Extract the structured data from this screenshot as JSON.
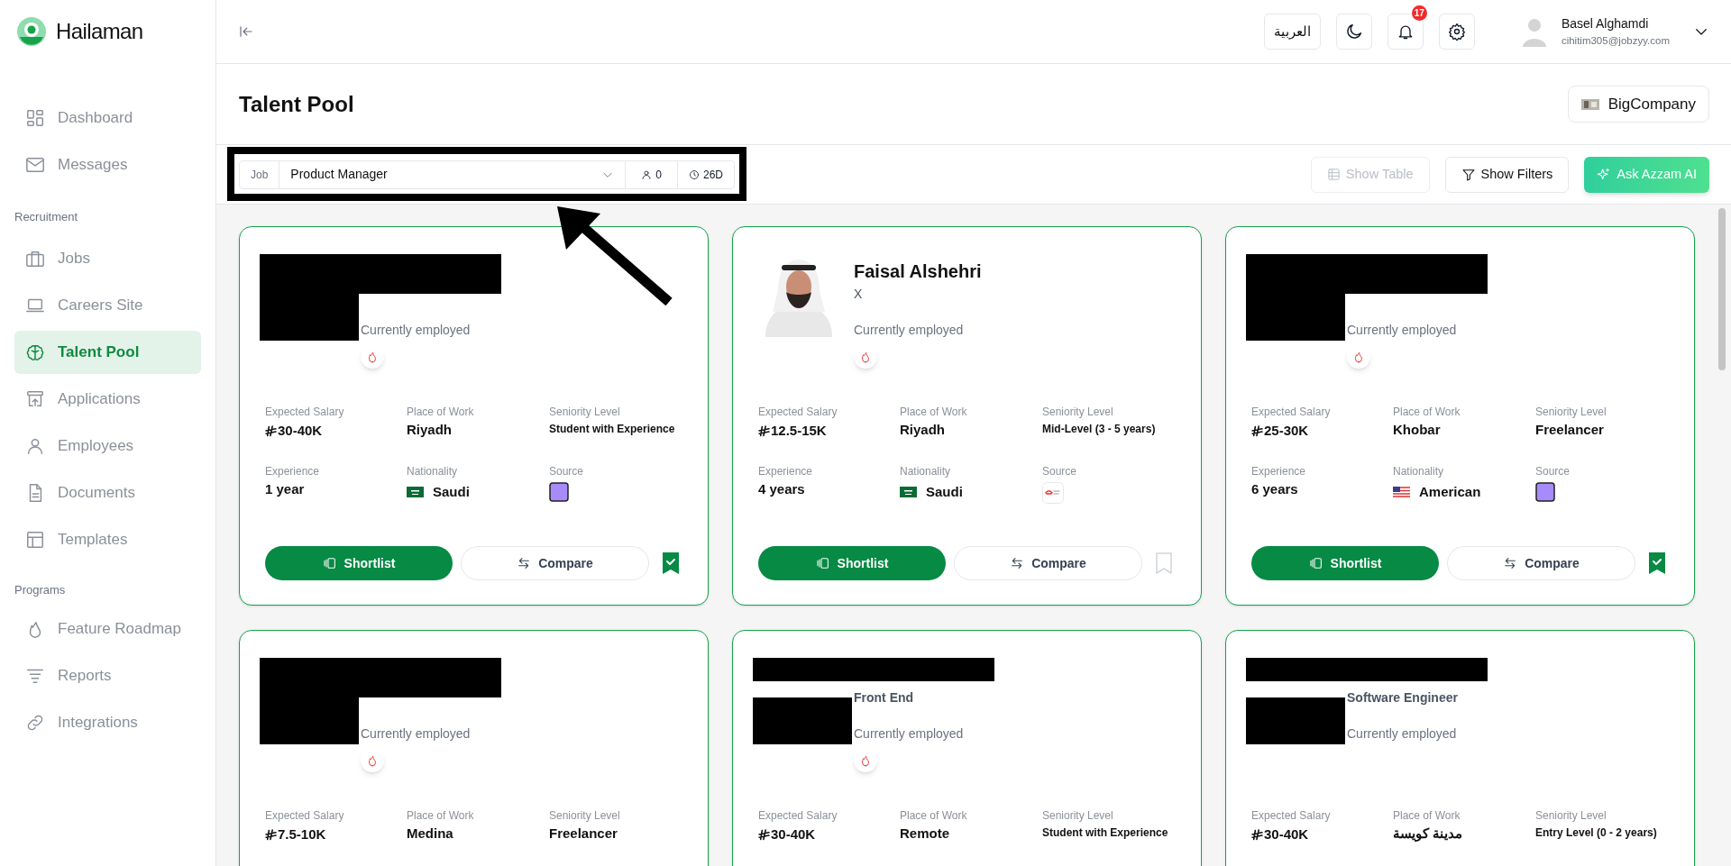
{
  "sidebar": {
    "brand": "Hailaman",
    "sections": [
      {
        "items": [
          {
            "label": "Dashboard",
            "kind": "grid",
            "selected": false
          },
          {
            "label": "Messages",
            "kind": "mail",
            "selected": false
          }
        ]
      },
      {
        "title": "Recruitment",
        "items": [
          {
            "label": "Jobs",
            "kind": "briefcase",
            "selected": false
          },
          {
            "label": "Careers Site",
            "kind": "laptop",
            "selected": false
          },
          {
            "label": "Talent Pool",
            "kind": "brain",
            "selected": true
          },
          {
            "label": "Applications",
            "kind": "upload",
            "selected": false
          },
          {
            "label": "Employees",
            "kind": "user",
            "selected": false
          },
          {
            "label": "Documents",
            "kind": "file",
            "selected": false
          },
          {
            "label": "Templates",
            "kind": "layout",
            "selected": false
          }
        ]
      },
      {
        "title": "Programs",
        "items": [
          {
            "label": "Feature Roadmap",
            "kind": "flame",
            "selected": false
          },
          {
            "label": "Reports",
            "kind": "lines",
            "selected": false
          },
          {
            "label": "Integrations",
            "kind": "link",
            "selected": false
          }
        ]
      }
    ]
  },
  "header": {
    "language": "العربية",
    "notifications": "17",
    "user": {
      "name": "Basel Alghamdi",
      "email": "cihitim305@jobzyy.com"
    }
  },
  "page": {
    "title": "Talent Pool",
    "company": "BigCompany"
  },
  "toolbar": {
    "job_label": "Job",
    "job": "Product Manager",
    "applicants": "0",
    "age": "26D",
    "buttons": [
      {
        "label": "Show Table",
        "kind": "table",
        "disabled": true
      },
      {
        "label": "Show Filters",
        "kind": "filter",
        "disabled": false
      },
      {
        "label": "Ask Azzam AI",
        "kind": "ai",
        "disabled": false
      }
    ]
  },
  "cards": [
    {
      "redacted": true,
      "status": "Currently employed",
      "hot": true,
      "bookmarked": true,
      "details": [
        {
          "label": "Expected Salary",
          "value": "30-40K",
          "kind": "salary"
        },
        {
          "label": "Place of Work",
          "value": "Riyadh",
          "kind": "text"
        },
        {
          "label": "Seniority Level",
          "value": "Student with Experience",
          "kind": "small"
        },
        {
          "label": "Experience",
          "value": "1 year",
          "kind": "text"
        },
        {
          "label": "Nationality",
          "value": "Saudi",
          "kind": "saflag"
        },
        {
          "label": "Source",
          "kind": "purplesource"
        }
      ],
      "actions": [
        "Shortlist",
        "Compare"
      ]
    },
    {
      "redacted": false,
      "name": "Faisal Alshehri",
      "subtitle": "X",
      "status": "Currently employed",
      "hot": true,
      "bookmarked": false,
      "details": [
        {
          "label": "Expected Salary",
          "value": "12.5-15K",
          "kind": "salary"
        },
        {
          "label": "Place of Work",
          "value": "Riyadh",
          "kind": "text"
        },
        {
          "label": "Seniority Level",
          "value": "Mid-Level (3 - 5 years)",
          "kind": "small"
        },
        {
          "label": "Experience",
          "value": "4 years",
          "kind": "text"
        },
        {
          "label": "Nationality",
          "value": "Saudi",
          "kind": "saflag"
        },
        {
          "label": "Source",
          "kind": "logosource"
        }
      ],
      "actions": [
        "Shortlist",
        "Compare"
      ]
    },
    {
      "redacted": true,
      "status": "Currently employed",
      "hot": true,
      "bookmarked": true,
      "details": [
        {
          "label": "Expected Salary",
          "value": "25-30K",
          "kind": "salary"
        },
        {
          "label": "Place of Work",
          "value": "Khobar",
          "kind": "text"
        },
        {
          "label": "Seniority Level",
          "value": "Freelancer",
          "kind": "text"
        },
        {
          "label": "Experience",
          "value": "6 years",
          "kind": "text"
        },
        {
          "label": "Nationality",
          "value": "American",
          "kind": "usflag"
        },
        {
          "label": "Source",
          "kind": "purplesource"
        }
      ],
      "actions": [
        "Shortlist",
        "Compare"
      ]
    },
    {
      "redacted": true,
      "status": "Currently employed",
      "hot": true,
      "details": [
        {
          "label": "Expected Salary",
          "value": "7.5-10K",
          "kind": "salary"
        },
        {
          "label": "Place of Work",
          "value": "Medina",
          "kind": "text"
        },
        {
          "label": "Seniority Level",
          "value": "Freelancer",
          "kind": "text"
        }
      ]
    },
    {
      "redacted": true,
      "subtitle": "Front End",
      "status": "Currently employed",
      "hot": true,
      "details": [
        {
          "label": "Expected Salary",
          "value": "30-40K",
          "kind": "salary"
        },
        {
          "label": "Place of Work",
          "value": "Remote",
          "kind": "text"
        },
        {
          "label": "Seniority Level",
          "value": "Student with Experience",
          "kind": "small"
        }
      ]
    },
    {
      "redacted": true,
      "subtitle": "Software Engineer",
      "status": "Currently employed",
      "hot": false,
      "details": [
        {
          "label": "Expected Salary",
          "value": "30-40K",
          "kind": "salary"
        },
        {
          "label": "Place of Work",
          "value": "مدينة كويسة",
          "kind": "text"
        },
        {
          "label": "Seniority Level",
          "value": "Entry Level (0 - 2 years)",
          "kind": "small"
        }
      ]
    }
  ]
}
